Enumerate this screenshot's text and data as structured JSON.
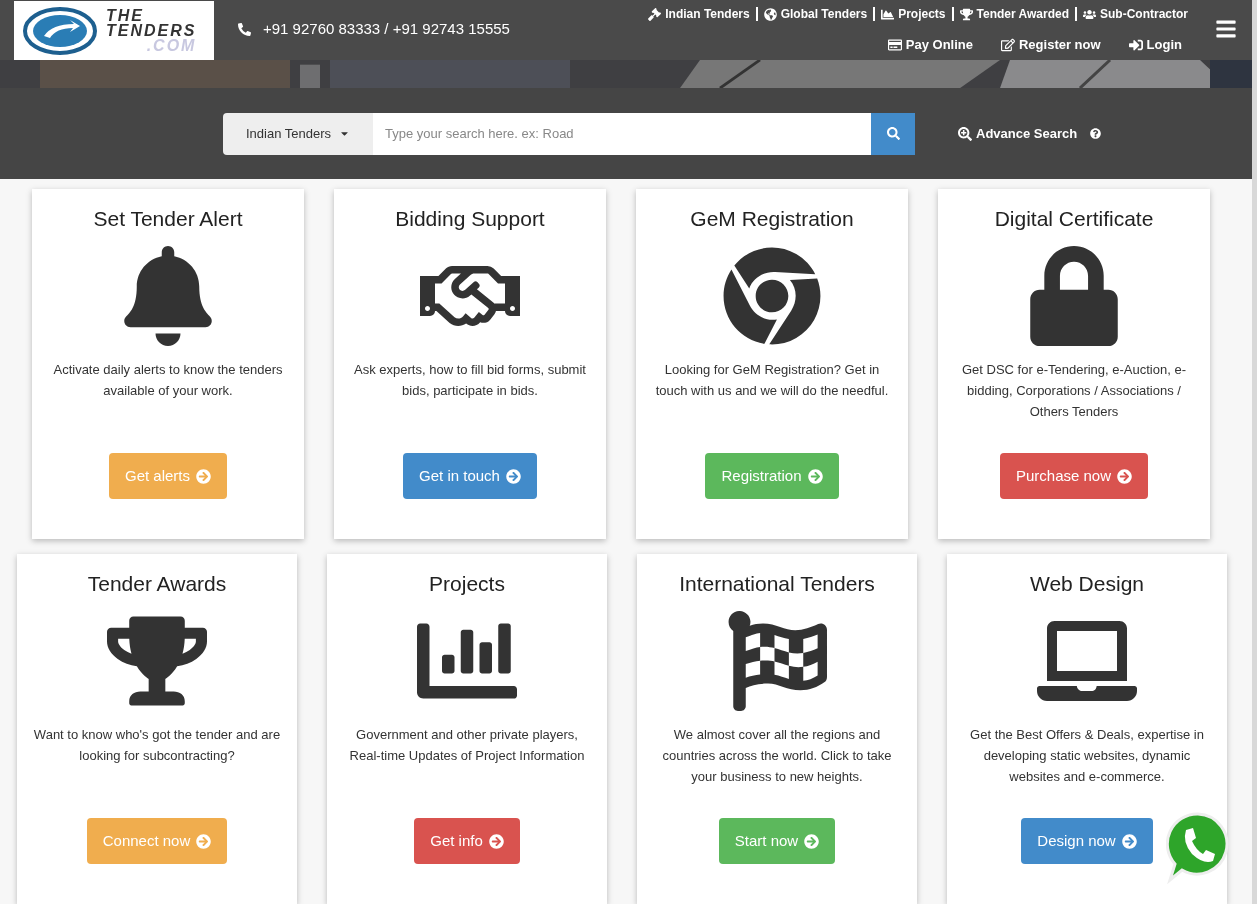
{
  "header": {
    "logo": {
      "line_1": "THE",
      "line_2": "TENDERS",
      "line_3": ".COM"
    },
    "phone": "+91 92760 83333 / +91 92743 15555",
    "top_links": [
      {
        "label": "Indian Tenders",
        "kind": "gavel"
      },
      {
        "label": "Global Tenders",
        "kind": "globe"
      },
      {
        "label": "Projects",
        "kind": "area-chart"
      },
      {
        "label": "Tender Awarded",
        "kind": "trophy"
      },
      {
        "label": "Sub-Contractor",
        "kind": "users"
      }
    ],
    "account_links": [
      {
        "label": "Pay Online",
        "kind": "card"
      },
      {
        "label": "Register now",
        "kind": "edit"
      },
      {
        "label": "Login",
        "kind": "sign-in"
      }
    ]
  },
  "search": {
    "category": "Indian Tenders",
    "placeholder": "Type your search here. ex: Road",
    "advance_search": "Advance Search"
  },
  "cards": [
    {
      "title": "Set Tender Alert",
      "kind": "bell",
      "description": "Activate daily alerts to know the tenders available of your work.",
      "button": "Get alerts",
      "color": "#f0ad4e"
    },
    {
      "title": "Bidding Support",
      "kind": "handshake",
      "description": "Ask experts, how to fill bid forms, submit bids, participate in bids.",
      "button": "Get in touch",
      "color": "#428bca"
    },
    {
      "title": "GeM Registration",
      "kind": "chrome",
      "description": "Looking for GeM Registration? Get in touch with us and we will do the needful.",
      "button": "Registration",
      "color": "#5cb85c"
    },
    {
      "title": "Digital Certificate",
      "kind": "lock",
      "description": "Get DSC for e-Tendering, e-Auction, e-bidding, Corporations / Associations / Others Tenders",
      "button": "Purchase now",
      "color": "#d9534f"
    },
    {
      "title": "Tender Awards",
      "kind": "trophy",
      "description": "Want to know who's got the tender and are looking for subcontracting?",
      "button": "Connect now",
      "color": "#f0ad4e"
    },
    {
      "title": "Projects",
      "kind": "bar-chart",
      "description": "Government and other private players, Real-time Updates of Project Information",
      "button": "Get info",
      "color": "#d9534f"
    },
    {
      "title": "International Tenders",
      "kind": "flag",
      "description": "We almost cover all the regions and countries across the world. Click to take your business to new heights.",
      "button": "Start now",
      "color": "#5cb85c"
    },
    {
      "title": "Web Design",
      "kind": "laptop",
      "description": "Get the Best Offers & Deals, expertise in developing static websites, dynamic websites and e-commerce.",
      "button": "Design now",
      "color": "#428bca"
    }
  ]
}
